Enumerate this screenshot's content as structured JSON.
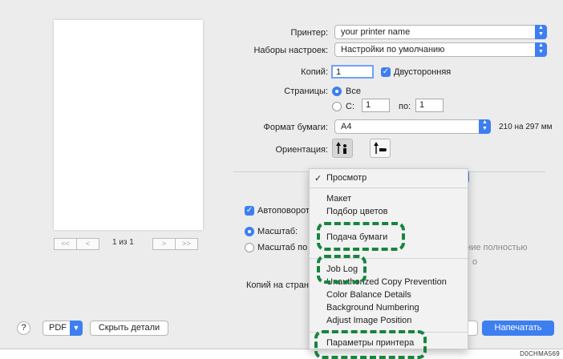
{
  "preview": {
    "pager_first": "<<",
    "pager_prev": "<",
    "page_indicator": "1 из 1",
    "pager_next": ">",
    "pager_last": ">>"
  },
  "printer": {
    "label": "Принтер:",
    "value": "your printer name"
  },
  "presets": {
    "label": "Наборы настроек:",
    "value": "Настройки по умолчанию"
  },
  "copies": {
    "label": "Копий:",
    "value": "1",
    "duplex_label": "Двусторонняя",
    "duplex_checked": true
  },
  "pages": {
    "label": "Страницы:",
    "all_label": "Все",
    "from_label": "С:",
    "from_value": "1",
    "to_label": "по:",
    "to_value": "1"
  },
  "paper": {
    "label": "Формат бумаги:",
    "value": "A4",
    "dimensions": "210 на 297 мм"
  },
  "orientation": {
    "label": "Ориентация:",
    "portrait_icon": "portrait-orientation-icon",
    "landscape_icon": "landscape-orientation-icon"
  },
  "layout_options": {
    "auto_rotate": "Автоповорот",
    "scale_label": "Масштаб:",
    "scale_fit_label": "Масштаб по",
    "fit_hint_1": "ение полностью",
    "fit_hint_2": "о",
    "copies_per_page": "Копий на стран"
  },
  "menu": {
    "checked_item": "Просмотр",
    "check_mark": "✓",
    "items_group1": [
      "Макет",
      "Подбор цветов",
      "Подача бумаги"
    ],
    "items_group2": [
      "Job Log",
      "Unauthorized Copy Prevention",
      "Color Balance Details",
      "Background Numbering",
      "Adjust Image Position"
    ],
    "items_group3": [
      "Параметры принтера"
    ]
  },
  "footer": {
    "help": "?",
    "pdf": "PDF",
    "hide_details": "Скрыть детали",
    "print": "Напечатать",
    "code": "D0CHMA569"
  },
  "colors": {
    "accent": "#3d7ff0",
    "highlight_dash": "#16853d",
    "dialog_bg": "#ececec"
  }
}
